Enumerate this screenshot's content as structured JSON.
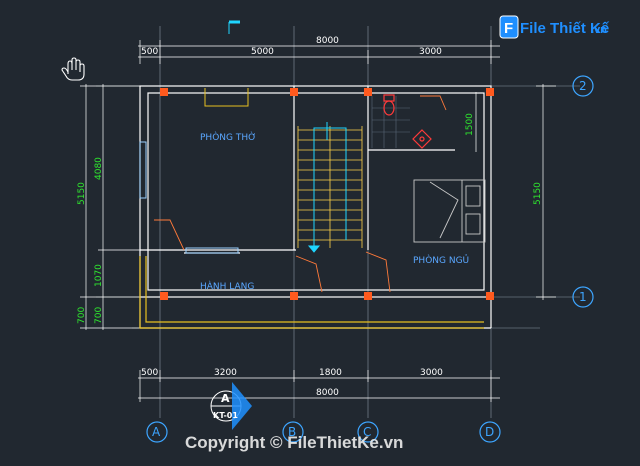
{
  "brand": {
    "logo_letter": "F",
    "name": "File Thiết Kế",
    "tld": ".vn"
  },
  "watermark": "Copyright © FileThietKe.vn",
  "section_marker": {
    "letter": "A",
    "sheet": "KT-01"
  },
  "rooms": {
    "phong_tho": "PHÒNG THỜ",
    "hanh_lang": "HÀNH LANG",
    "phong_ngu": "PHÒNG NGỦ"
  },
  "dims_top": {
    "total": "8000",
    "left_offset": "500",
    "segment_a": "5000",
    "segment_b": "3000"
  },
  "dims_bottom": {
    "left_offset": "500",
    "segment_a": "3200",
    "segment_b": "1800",
    "segment_c": "3000",
    "total": "8000"
  },
  "dims_left": {
    "d1": "4080",
    "d2": "1070",
    "d3": "700",
    "total": "5150",
    "offset": "700"
  },
  "dims_right": {
    "total": "5150",
    "wc": "1500"
  },
  "axes": {
    "h1": "2",
    "h2": "1",
    "v1": "A",
    "v2": "B",
    "v3": "C",
    "v4": "D"
  },
  "colors": {
    "background": "#212830",
    "wall": "#ffffff",
    "column": "#ff5a1e",
    "axis": "#3da5ff",
    "dimension": "#2ee62e",
    "stair": "#ffd24a"
  }
}
